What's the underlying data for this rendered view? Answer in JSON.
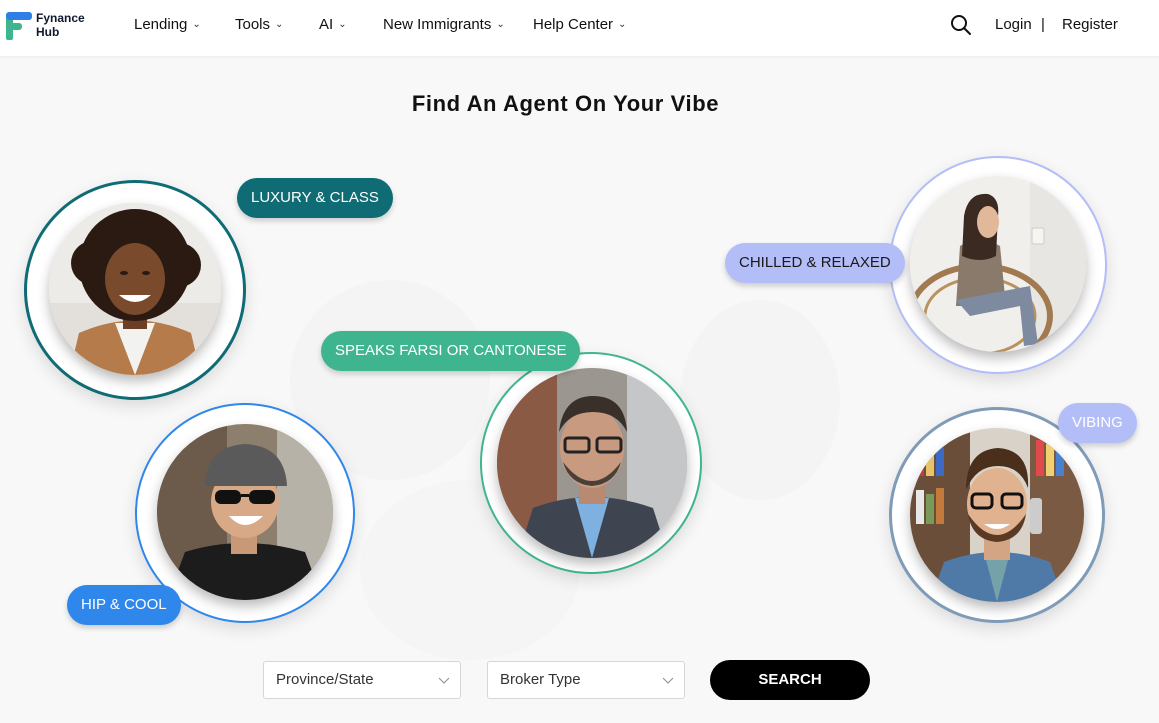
{
  "brand": {
    "line1": "Fynance",
    "line2": "Hub"
  },
  "nav": {
    "items": [
      {
        "label": "Lending"
      },
      {
        "label": "Tools"
      },
      {
        "label": "AI"
      },
      {
        "label": "New Immigrants"
      },
      {
        "label": "Help Center"
      }
    ],
    "login": "Login",
    "separator": "|",
    "register": "Register"
  },
  "title": "Find An Agent On Your Vibe",
  "vibes": [
    {
      "label": "LUXURY & CLASS",
      "color": "#0f6b74",
      "text_color": "#ffffff"
    },
    {
      "label": "HIP & COOL",
      "color": "#2f86eb",
      "text_color": "#ffffff"
    },
    {
      "label": "SPEAKS FARSI OR CANTONESE",
      "color": "#3fb58f",
      "text_color": "#ffffff"
    },
    {
      "label": "CHILLED & RELAXED",
      "color": "#b3bdf7",
      "text_color": "#1a1a1a"
    },
    {
      "label": "VIBING",
      "color": "#b3bdf7",
      "text_color": "#ffffff"
    }
  ],
  "filters": {
    "province_placeholder": "Province/State",
    "broker_placeholder": "Broker Type",
    "search_label": "SEARCH"
  },
  "icons": {
    "search": "search-icon",
    "chevron": "chevron-down-icon",
    "logo": "fynance-hub-logo"
  }
}
